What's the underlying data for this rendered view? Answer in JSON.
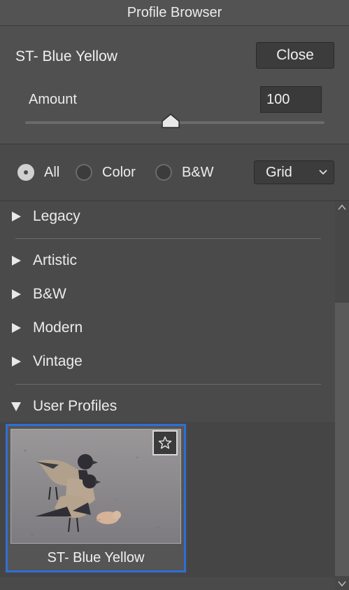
{
  "window": {
    "title": "Profile Browser"
  },
  "header": {
    "profile_name": "ST- Blue Yellow",
    "close_label": "Close",
    "amount_label": "Amount",
    "amount_value": "100",
    "amount_slider_fraction": 0.5
  },
  "filters": {
    "options": [
      {
        "label": "All",
        "checked": true
      },
      {
        "label": "Color",
        "checked": false
      },
      {
        "label": "B&W",
        "checked": false
      }
    ],
    "view_label": "Grid"
  },
  "groups": [
    {
      "label": "Legacy",
      "expanded": false
    },
    {
      "label": "Artistic",
      "expanded": false
    },
    {
      "label": "B&W",
      "expanded": false
    },
    {
      "label": "Modern",
      "expanded": false
    },
    {
      "label": "Vintage",
      "expanded": false
    },
    {
      "label": "User Profiles",
      "expanded": true
    }
  ],
  "user_profiles": {
    "items": [
      {
        "name": "ST- Blue Yellow",
        "selected": true,
        "favorite": false
      }
    ]
  },
  "colors": {
    "selection": "#2f6fd6",
    "background": "#4a4a4a"
  }
}
